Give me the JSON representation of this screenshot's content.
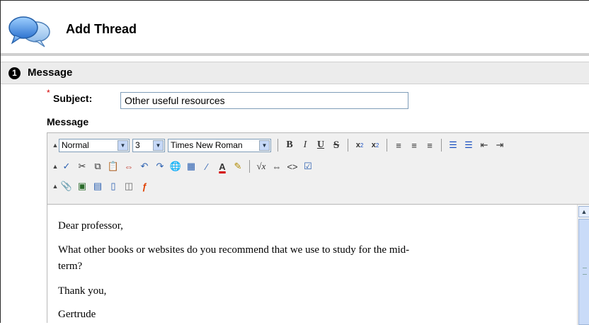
{
  "header": {
    "title": "Add Thread",
    "icon": "speech-bubbles-icon"
  },
  "step": {
    "number": "1",
    "label": "Message"
  },
  "subject": {
    "required_marker": "*",
    "label": "Subject:",
    "value": "Other useful resources"
  },
  "message": {
    "label": "Message"
  },
  "toolbar": {
    "format_select": "Normal",
    "size_select": "3",
    "font_select": "Times New Roman",
    "bold": "B",
    "italic": "I",
    "underline": "U",
    "strike": "S"
  },
  "body": {
    "greeting": "Dear professor,",
    "line1": "What other books or websites do you recommend that we use to study for the mid-",
    "line2": "term?",
    "closing": "Thank you,",
    "signature": "Gertrude"
  },
  "colors": {
    "accent_blue": "#3e7fd0",
    "required": "#d40000",
    "step_bar": "#ececec"
  }
}
